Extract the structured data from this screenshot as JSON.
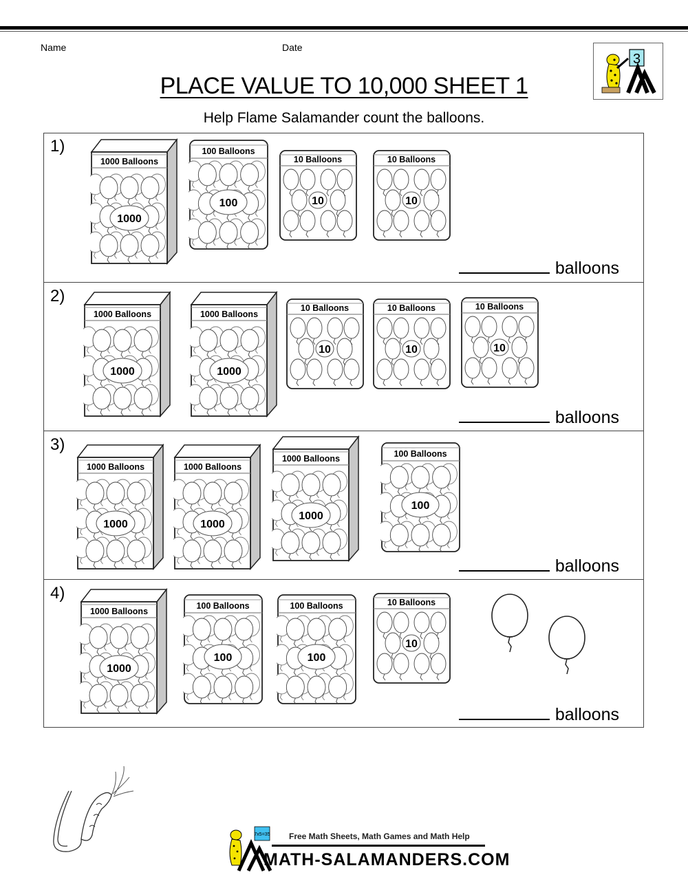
{
  "header": {
    "name_label": "Name",
    "date_label": "Date",
    "title": "PLACE VALUE TO 10,000 SHEET 1",
    "subtitle": "Help Flame Salamander count the balloons.",
    "grade_badge": "3"
  },
  "answer_suffix": "balloons",
  "questions": [
    {
      "number": "1)",
      "items": [
        {
          "type": "box1000",
          "label": "1000 Balloons",
          "value": "1000"
        },
        {
          "type": "box100",
          "label": "100 Balloons",
          "value": "100"
        },
        {
          "type": "box10",
          "label": "10 Balloons",
          "value": "10"
        },
        {
          "type": "box10",
          "label": "10 Balloons",
          "value": "10"
        }
      ]
    },
    {
      "number": "2)",
      "items": [
        {
          "type": "box1000",
          "label": "1000 Balloons",
          "value": "1000"
        },
        {
          "type": "box1000",
          "label": "1000 Balloons",
          "value": "1000"
        },
        {
          "type": "box10",
          "label": "10 Balloons",
          "value": "10"
        },
        {
          "type": "box10",
          "label": "10 Balloons",
          "value": "10"
        },
        {
          "type": "box10",
          "label": "10 Balloons",
          "value": "10"
        }
      ]
    },
    {
      "number": "3)",
      "items": [
        {
          "type": "box1000",
          "label": "1000 Balloons",
          "value": "1000"
        },
        {
          "type": "box1000",
          "label": "1000 Balloons",
          "value": "1000"
        },
        {
          "type": "box1000",
          "label": "1000 Balloons",
          "value": "1000"
        },
        {
          "type": "box100",
          "label": "100 Balloons",
          "value": "100"
        }
      ]
    },
    {
      "number": "4)",
      "items": [
        {
          "type": "box1000",
          "label": "1000 Balloons",
          "value": "1000"
        },
        {
          "type": "box100",
          "label": "100 Balloons",
          "value": "100"
        },
        {
          "type": "box100",
          "label": "100 Balloons",
          "value": "100"
        },
        {
          "type": "box10",
          "label": "10 Balloons",
          "value": "10"
        },
        {
          "type": "single",
          "label": "",
          "value": "1"
        },
        {
          "type": "single",
          "label": "",
          "value": "1"
        }
      ]
    }
  ],
  "footer": {
    "tagline": "Free Math Sheets, Math Games and Math Help",
    "site": "MATH-SALAMANDERS.COM",
    "board_text": "7x5=35"
  },
  "colors": {
    "logo_board": "#a8e8f0",
    "salamander_yellow": "#f5e400",
    "box_side_gray": "#c8c8c8"
  }
}
